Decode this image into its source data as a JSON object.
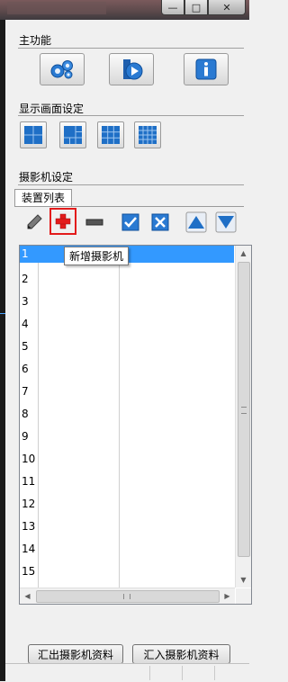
{
  "window": {
    "controls": [
      "—",
      "□",
      "✕"
    ]
  },
  "main_functions": {
    "title": "主功能",
    "buttons": [
      "gear-icon",
      "playback-icon",
      "info-icon"
    ]
  },
  "display_settings": {
    "title": "显示画面设定",
    "layouts": [
      "1x1",
      "1+3",
      "3x3",
      "4x4"
    ]
  },
  "camera_settings": {
    "title": "摄影机设定",
    "tab_label": "装置列表",
    "tooltip": "新增摄影机",
    "rows": [
      "1",
      "2",
      "3",
      "4",
      "5",
      "6",
      "7",
      "8",
      "9",
      "10",
      "11",
      "12",
      "13",
      "14",
      "15"
    ],
    "selected_row": "1",
    "hscroll_grip": "III"
  },
  "buttons": {
    "export": "汇出摄影机资料",
    "import": "汇入摄影机资料"
  },
  "colors": {
    "selection": "#3399ff",
    "highlight_border": "#e31b1b",
    "icon_blue": "#1f6fc6"
  }
}
